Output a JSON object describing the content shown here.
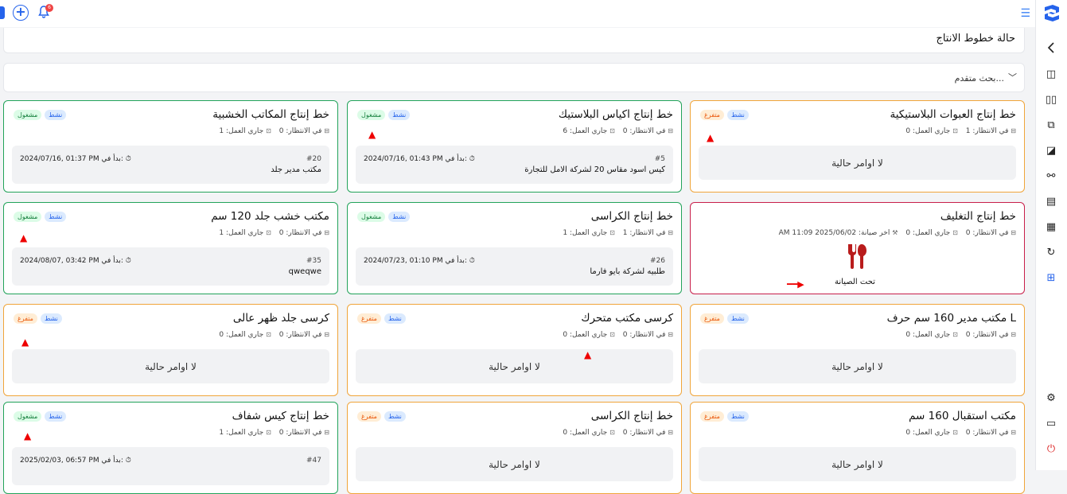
{
  "topbar": {
    "badge_count": "6"
  },
  "page_title": "حالة خطوط الانتاج",
  "search": {
    "label": "بحث متقدم..."
  },
  "labels": {
    "waiting": "في الانتظار:",
    "running": "جاري العمل:",
    "started_at": "بدأ في:",
    "no_orders": "لا اوامر حالية",
    "last_maintenance": "اخر صيانة:",
    "under_maintenance": "تحت الصيانة",
    "status_active": "نشط",
    "status_busy": "مشغول",
    "status_free": "متفرغ"
  },
  "lines": [
    {
      "name": "خط إنتاج المكاتب الخشبية",
      "state": "busy",
      "waiting": "0",
      "running": "1",
      "order_no": "#20",
      "order_name": "مكتب مدير جلد",
      "started": "2024/07/16, 01:37 PM"
    },
    {
      "name": "خط إنتاج اكياس البلاستيك",
      "state": "busy",
      "waiting": "0",
      "running": "6",
      "order_no": "#5",
      "order_name": "كيس اسود مقاس 20 لشركة الامل للتجارة",
      "started": "2024/07/16, 01:43 PM"
    },
    {
      "name": "خط إنتاج العبوات البلاستيكية",
      "state": "free",
      "waiting": "1",
      "running": "0"
    },
    {
      "name": "مكتب خشب جلد 120 سم",
      "state": "busy",
      "waiting": "0",
      "running": "1",
      "order_no": "#35",
      "order_name": "qweqwe",
      "started": "2024/08/07, 03:42 PM"
    },
    {
      "name": "خط إنتاج الكراسى",
      "state": "busy",
      "waiting": "1",
      "running": "1",
      "order_no": "#26",
      "order_name": "طلبيه لشركة بايو فارما",
      "started": "2024/07/23, 01:10 PM"
    },
    {
      "name": "خط إنتاج التغليف",
      "state": "maint",
      "waiting": "0",
      "running": "0",
      "last_maintenance": "2025/06/02 11:09 AM"
    },
    {
      "name": "كرسى جلد ظهر عالى",
      "state": "free",
      "waiting": "0",
      "running": "0"
    },
    {
      "name": "كرسى مكتب متحرك",
      "state": "free",
      "waiting": "0",
      "running": "0"
    },
    {
      "name": "مكتب مدير 160 سم حرف L",
      "state": "free",
      "waiting": "0",
      "running": "0"
    },
    {
      "name": "خط إنتاج كيس شفاف",
      "state": "busy",
      "waiting": "0",
      "running": "1",
      "order_no": "#47",
      "started": "2025/02/03, 06:57 PM"
    },
    {
      "name": "خط إنتاج الكراسى",
      "state": "free",
      "waiting": "0",
      "running": "0"
    },
    {
      "name": "مكتب استقبال 160 سم",
      "state": "free",
      "waiting": "0",
      "running": "0"
    }
  ],
  "colors": {
    "busy": "#22a35a",
    "free": "#f0a53a",
    "maint": "#c81e4a",
    "accent": "#2563eb"
  },
  "icons": [
    "logo-icon",
    "hamburger-icon",
    "plus-icon",
    "bell-icon",
    "chevron-left-icon",
    "settings-icon",
    "power-icon",
    "wrench-screwdriver-icon",
    "clock-icon",
    "box-icon"
  ]
}
